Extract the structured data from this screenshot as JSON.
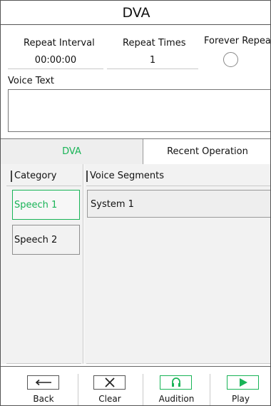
{
  "title": "DVA",
  "fields": {
    "repeat_interval": {
      "label": "Repeat Interval",
      "value": "00:00:00"
    },
    "repeat_times": {
      "label": "Repeat Times",
      "value": "1"
    },
    "forever_repeat": {
      "label": "Forever Repeat",
      "checked": false
    }
  },
  "voice_text": {
    "label": "Voice Text",
    "value": ""
  },
  "tabs": [
    {
      "label": "DVA",
      "active": true
    },
    {
      "label": "Recent Operation",
      "active": false
    }
  ],
  "category": {
    "header": "Category",
    "items": [
      {
        "label": "Speech 1",
        "active": true
      },
      {
        "label": "Speech 2",
        "active": false
      }
    ]
  },
  "segments": {
    "header": "Voice Segments",
    "items": [
      {
        "label": "System 1"
      }
    ]
  },
  "toolbar": {
    "back": {
      "label": "Back",
      "icon": "arrow-left-icon"
    },
    "clear": {
      "label": "Clear",
      "icon": "x-icon"
    },
    "audition": {
      "label": "Audition",
      "icon": "headphones-icon"
    },
    "play": {
      "label": "Play",
      "icon": "play-icon"
    }
  },
  "colors": {
    "accent": "#19b457",
    "panel": "#f2f2f2",
    "border": "#555555"
  }
}
